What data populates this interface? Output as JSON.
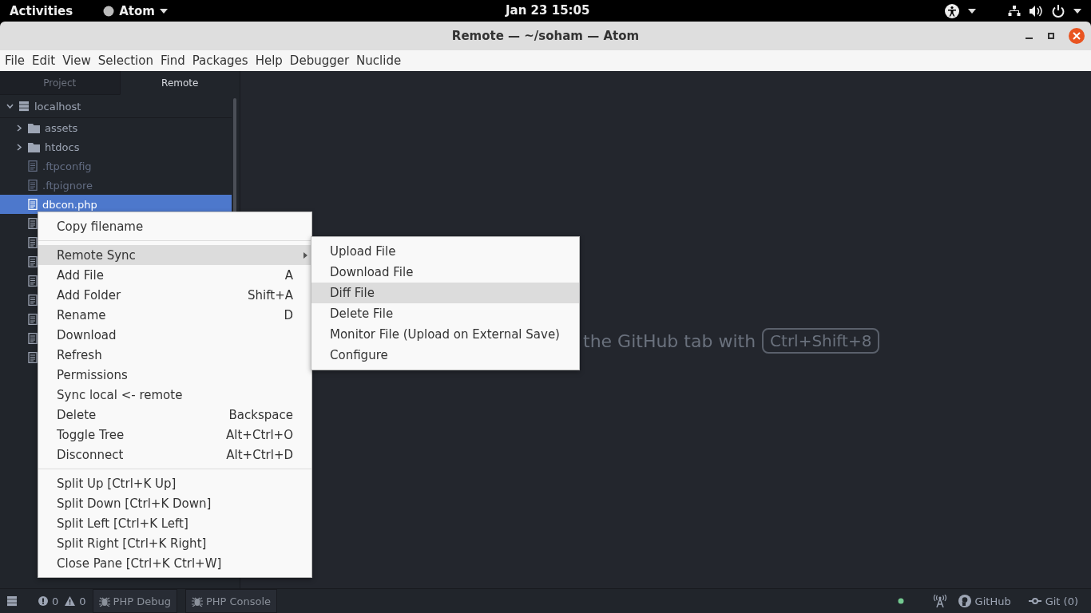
{
  "top_bar": {
    "activities": "Activities",
    "app": "Atom",
    "clock": "Jan 23  15:05"
  },
  "window": {
    "title": "Remote — ~/soham — Atom"
  },
  "menu_bar": [
    "File",
    "Edit",
    "View",
    "Selection",
    "Find",
    "Packages",
    "Help",
    "Debugger",
    "Nuclide"
  ],
  "panel_tabs": [
    {
      "label": "Project",
      "selected": false
    },
    {
      "label": "Remote",
      "selected": true
    }
  ],
  "tree": {
    "root": "localhost",
    "expanded": true,
    "items": [
      {
        "kind": "folder",
        "name": "assets",
        "expanded": false,
        "ignored": false,
        "selected": false
      },
      {
        "kind": "folder",
        "name": "htdocs",
        "expanded": false,
        "ignored": false,
        "selected": false
      },
      {
        "kind": "file",
        "name": ".ftpconfig",
        "ignored": true,
        "selected": false
      },
      {
        "kind": "file",
        "name": ".ftpignore",
        "ignored": true,
        "selected": false
      },
      {
        "kind": "file",
        "name": "dbcon.php",
        "ignored": false,
        "selected": true
      },
      {
        "kind": "file",
        "ignored": false,
        "selected": false
      },
      {
        "kind": "file",
        "ignored": false,
        "selected": false
      },
      {
        "kind": "file",
        "ignored": false,
        "selected": false
      },
      {
        "kind": "file",
        "ignored": false,
        "selected": false
      },
      {
        "kind": "file",
        "ignored": false,
        "selected": false
      },
      {
        "kind": "file",
        "ignored": false,
        "selected": false
      },
      {
        "kind": "file",
        "ignored": false,
        "selected": false
      },
      {
        "kind": "file",
        "ignored": false,
        "selected": false
      }
    ]
  },
  "editor": {
    "hint": "the GitHub tab with",
    "key": "Ctrl+Shift+8"
  },
  "context_menu": {
    "groups": [
      [
        {
          "label": "Copy filename",
          "selected": false
        }
      ],
      [
        {
          "label": "Remote Sync",
          "selected": true,
          "submenu": true
        },
        {
          "label": "Add File",
          "shortcut": "A",
          "selected": false
        },
        {
          "label": "Add Folder",
          "shortcut": "Shift+A",
          "selected": false
        },
        {
          "label": "Rename",
          "shortcut": "D",
          "selected": false
        },
        {
          "label": "Download",
          "selected": false
        },
        {
          "label": "Refresh",
          "selected": false
        },
        {
          "label": "Permissions",
          "selected": false
        },
        {
          "label": "Sync local <- remote",
          "selected": false
        },
        {
          "label": "Delete",
          "shortcut": "Backspace",
          "selected": false
        },
        {
          "label": "Toggle Tree",
          "shortcut": "Alt+Ctrl+O",
          "selected": false
        },
        {
          "label": "Disconnect",
          "shortcut": "Alt+Ctrl+D",
          "selected": false
        }
      ],
      [
        {
          "label": "Split Up [Ctrl+K Up]",
          "selected": false
        },
        {
          "label": "Split Down [Ctrl+K Down]",
          "selected": false
        },
        {
          "label": "Split Left [Ctrl+K Left]",
          "selected": false
        },
        {
          "label": "Split Right [Ctrl+K Right]",
          "selected": false
        },
        {
          "label": "Close Pane [Ctrl+K Ctrl+W]",
          "selected": false
        }
      ]
    ]
  },
  "submenu": [
    {
      "label": "Upload File",
      "selected": false
    },
    {
      "label": "Download File",
      "selected": false
    },
    {
      "label": "Diff File",
      "selected": true
    },
    {
      "label": "Delete File",
      "selected": false
    },
    {
      "label": "Monitor File (Upload on External Save)",
      "selected": false
    },
    {
      "label": "Configure",
      "selected": false
    }
  ],
  "status_bar": {
    "errors": "0",
    "warnings": "0",
    "buttons": [
      "PHP Debug",
      "PHP Console"
    ],
    "github": "GitHub",
    "git": "Git (0)"
  }
}
